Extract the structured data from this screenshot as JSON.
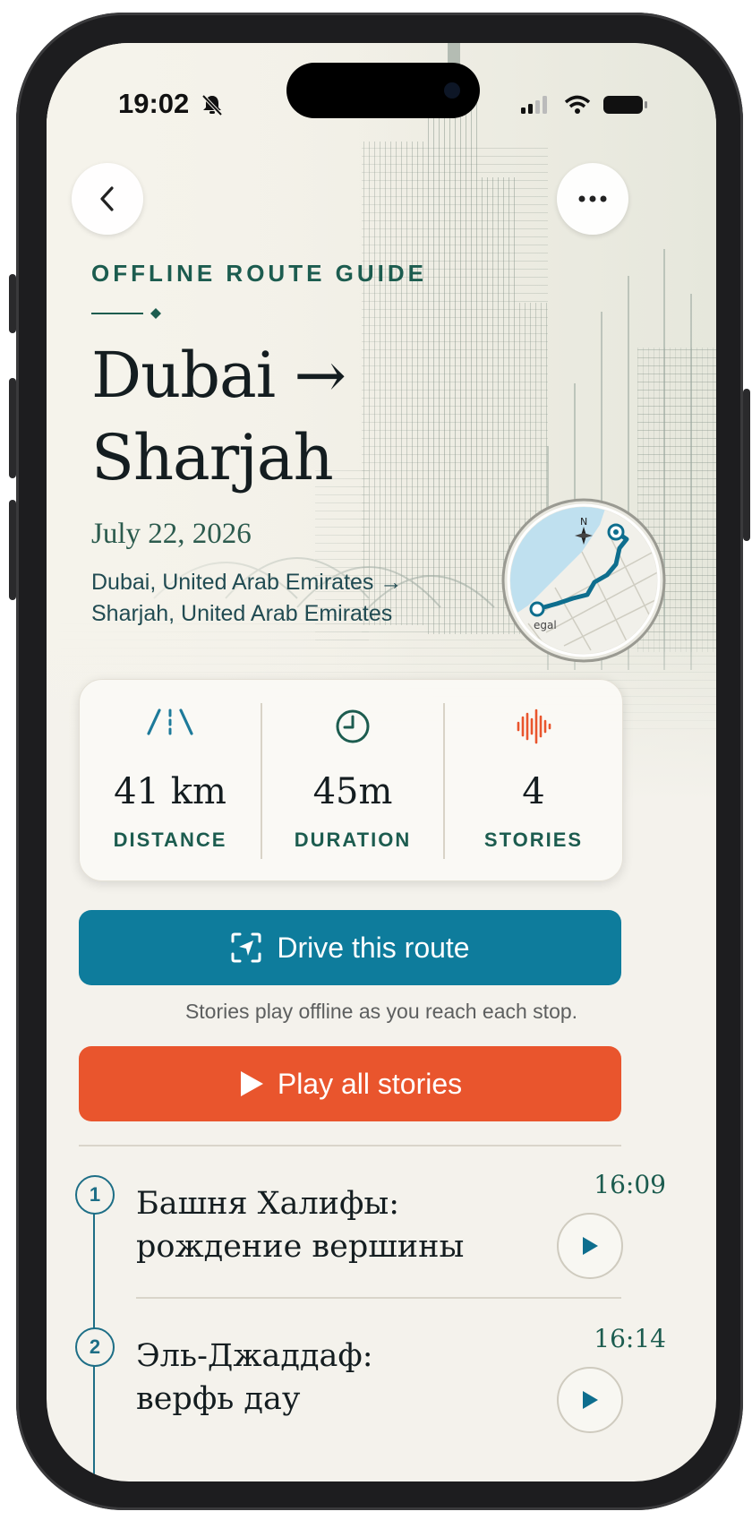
{
  "status": {
    "time": "19:02"
  },
  "header": {
    "eyebrow": "OFFLINE ROUTE GUIDE",
    "title_line1": "Dubai →",
    "title_line2": "Sharjah",
    "date": "July 22, 2026",
    "route_from": "Dubai, United Arab Emirates →",
    "route_to": "Sharjah, United Arab Emirates"
  },
  "map": {
    "label": "egal"
  },
  "stats": [
    {
      "icon": "road-icon",
      "value": "41 km",
      "label": "DISTANCE"
    },
    {
      "icon": "clock-icon",
      "value": "45m",
      "label": "DURATION"
    },
    {
      "icon": "waveform-icon",
      "value": "4",
      "label": "STORIES"
    }
  ],
  "actions": {
    "drive_label": "Drive this route",
    "drive_hint": "Stories play offline as you reach each stop.",
    "play_all_label": "Play all stories"
  },
  "stories": [
    {
      "number": "1",
      "title_line1": "Башня Халифы:",
      "title_line2": "рождение вершины",
      "time": "16:09"
    },
    {
      "number": "2",
      "title_line1": "Эль-Джаддаф:",
      "title_line2": "верфь дау",
      "time": "16:14"
    }
  ],
  "colors": {
    "accent_teal": "#0e7c9c",
    "accent_orange": "#e9552d",
    "text_green": "#1c5c4f",
    "background": "#f4f2ec"
  }
}
